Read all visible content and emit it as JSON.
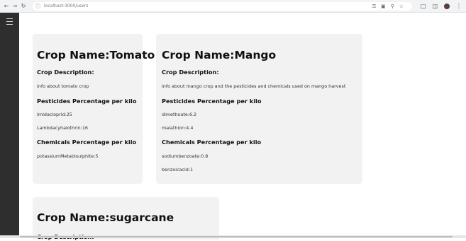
{
  "browser": {
    "back_icon": "arrow-left-icon",
    "forward_icon": "arrow-right-icon",
    "reload_icon": "reload-icon",
    "url": "localhost:3000/users"
  },
  "cards": [
    {
      "title": "Crop Name:Tomato",
      "desc_heading": "Crop Description:",
      "description": "info about tomato crop",
      "pesticides_heading": "Pesticides Percentage per kilo",
      "pesticides": [
        "Imidacloprid:25",
        "Lambdacyhalothrin:16"
      ],
      "chemicals_heading": "Chemicals Percentage per kilo",
      "chemicals": [
        "potassiumMetabisulphite:5"
      ]
    },
    {
      "title": "Crop Name:Mango",
      "desc_heading": "Crop Description:",
      "description": "info about mango crop and the pesticides and chemicals used on mango harvest",
      "pesticides_heading": "Pesticides Percentage per kilo",
      "pesticides": [
        "dimethoate:6.2",
        "malathion:4.4"
      ],
      "chemicals_heading": "Chemicals Percentage per kilo",
      "chemicals": [
        "sodiumbenzoate:0.8",
        "benzoicacid:1"
      ]
    },
    {
      "title": "Crop Name:sugarcane",
      "desc_heading": "Crop Description:"
    }
  ]
}
